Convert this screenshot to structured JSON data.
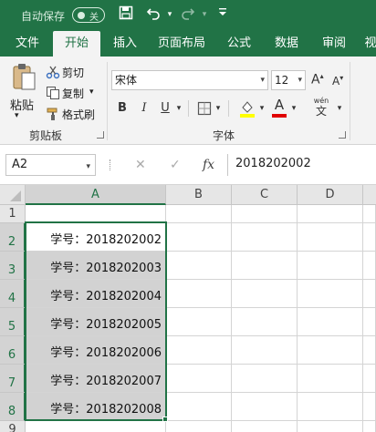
{
  "titlebar": {
    "autosave_label": "自动保存",
    "autosave_state": "关",
    "bg_color": "#217346"
  },
  "icons": {
    "save": "save-icon",
    "undo": "undo-icon",
    "redo": "redo-icon",
    "customize": "customize-qat-icon"
  },
  "tabs": [
    {
      "label": "文件",
      "active": false
    },
    {
      "label": "开始",
      "active": true
    },
    {
      "label": "插入",
      "active": false
    },
    {
      "label": "页面布局",
      "active": false
    },
    {
      "label": "公式",
      "active": false
    },
    {
      "label": "数据",
      "active": false
    },
    {
      "label": "审阅",
      "active": false
    },
    {
      "label": "视",
      "active": false
    }
  ],
  "ribbon": {
    "clipboard": {
      "paste": "粘贴",
      "cut": "剪切",
      "copy": "复制",
      "format_painter": "格式刷",
      "group_label": "剪贴板"
    },
    "font": {
      "font_name": "宋体",
      "font_size": "12",
      "bold": "B",
      "italic": "I",
      "underline": "U",
      "font_color_letter": "A",
      "wen": "wén",
      "wen_char": "文",
      "grow": "A",
      "shrink": "A",
      "group_label": "字体"
    }
  },
  "formula_bar": {
    "name_box": "A2",
    "cancel": "✕",
    "enter": "✓",
    "fx": "fx",
    "value": "2018202002"
  },
  "grid": {
    "columns": [
      "A",
      "B",
      "C",
      "D"
    ],
    "rows": [
      "1",
      "2",
      "3",
      "4",
      "5",
      "6",
      "7",
      "8",
      "9"
    ],
    "cells_a": [
      "",
      "学号：2018202002",
      "学号：2018202003",
      "学号：2018202004",
      "学号：2018202005",
      "学号：2018202006",
      "学号：2018202007",
      "学号：2018202008",
      ""
    ],
    "selected_range": "A2:A8"
  }
}
